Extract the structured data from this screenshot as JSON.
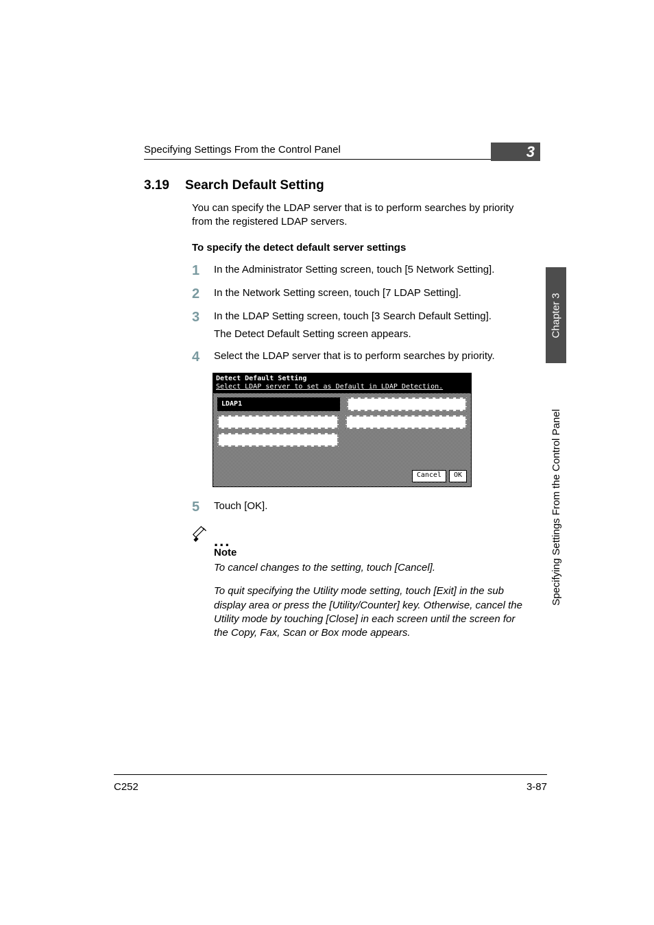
{
  "header": {
    "running": "Specifying Settings From the Control Panel",
    "chapter_tab": "3"
  },
  "side": {
    "chapter": "Chapter 3",
    "title": "Specifying Settings From the Control Panel"
  },
  "section": {
    "number": "3.19",
    "title": "Search Default Setting",
    "intro": "You can specify the LDAP server that is to perform searches by priority from the registered LDAP servers.",
    "subhead": "To specify the detect default server settings"
  },
  "steps": {
    "s1": {
      "n": "1",
      "body": "In the Administrator Setting screen, touch [5 Network Setting]."
    },
    "s2": {
      "n": "2",
      "body": "In the Network Setting screen, touch [7 LDAP Setting]."
    },
    "s3": {
      "n": "3",
      "body": "In the LDAP Setting screen, touch [3 Search Default Setting].",
      "sub": "The Detect Default Setting screen appears."
    },
    "s4": {
      "n": "4",
      "body": "Select the LDAP server that is to perform searches by priority."
    },
    "s5": {
      "n": "5",
      "body": "Touch [OK]."
    }
  },
  "screenshot": {
    "title": "Detect Default Setting",
    "sub": "Select LDAP server to set as Default in LDAP Detection.",
    "btn1": "LDAP1",
    "cancel": "Cancel",
    "ok": "OK"
  },
  "note": {
    "label": "Note",
    "p1": "To cancel changes to the setting, touch [Cancel].",
    "p2": "To quit specifying the Utility mode setting, touch [Exit] in the sub display area or press the [Utility/Counter] key. Otherwise, cancel the Utility mode by touching [Close] in each screen until the screen for the Copy, Fax, Scan or Box mode appears."
  },
  "footer": {
    "model": "C252",
    "page": "3-87"
  }
}
